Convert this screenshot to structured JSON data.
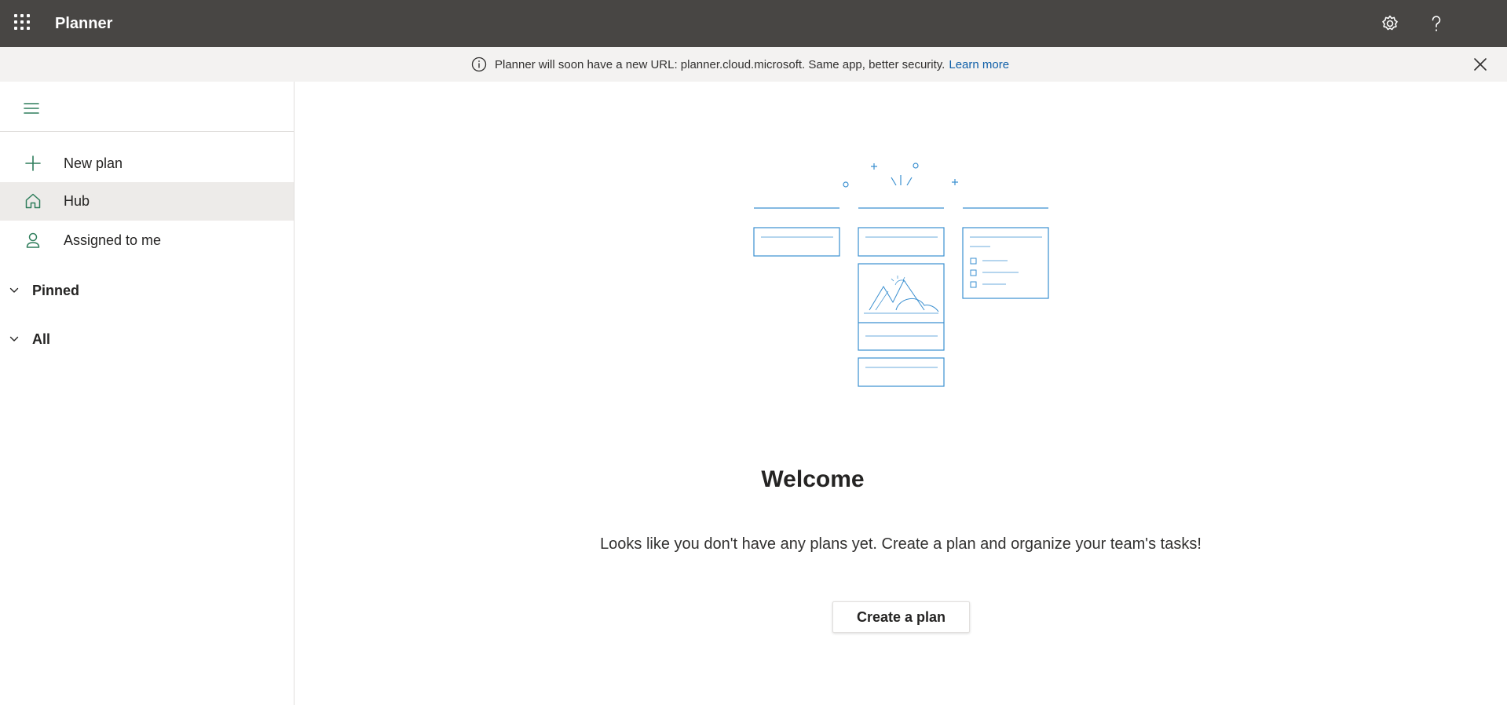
{
  "colors": {
    "topbar_bg": "#484644",
    "banner_bg": "#f3f2f1",
    "accent_green": "#2e7d5b",
    "illustration_blue": "#3a8fd0",
    "link_blue": "#0f5fa8",
    "selected_bg": "#edebe9"
  },
  "topbar": {
    "app_name": "Planner",
    "icons": [
      "app-launcher-icon",
      "settings-icon",
      "help-icon"
    ]
  },
  "banner": {
    "icon": "info-icon",
    "message": "Planner will soon have a new URL: planner.cloud.microsoft. Same app, better security.",
    "link_label": "Learn more",
    "close_icon": "close-icon"
  },
  "sidebar": {
    "menu_icon": "hamburger-icon",
    "items": [
      {
        "label": "New plan",
        "icon": "plus-icon",
        "selected": false
      },
      {
        "label": "Hub",
        "icon": "home-icon",
        "selected": true
      },
      {
        "label": "Assigned to me",
        "icon": "person-icon",
        "selected": false
      }
    ],
    "groups": [
      {
        "label": "Pinned",
        "icon": "chevron-down-icon"
      },
      {
        "label": "All",
        "icon": "chevron-down-icon"
      }
    ]
  },
  "main": {
    "illustration": "empty-board-illustration",
    "title": "Welcome",
    "message": "Looks like you don't have any plans yet. Create a plan and organize your team's tasks!",
    "button_label": "Create a plan"
  }
}
